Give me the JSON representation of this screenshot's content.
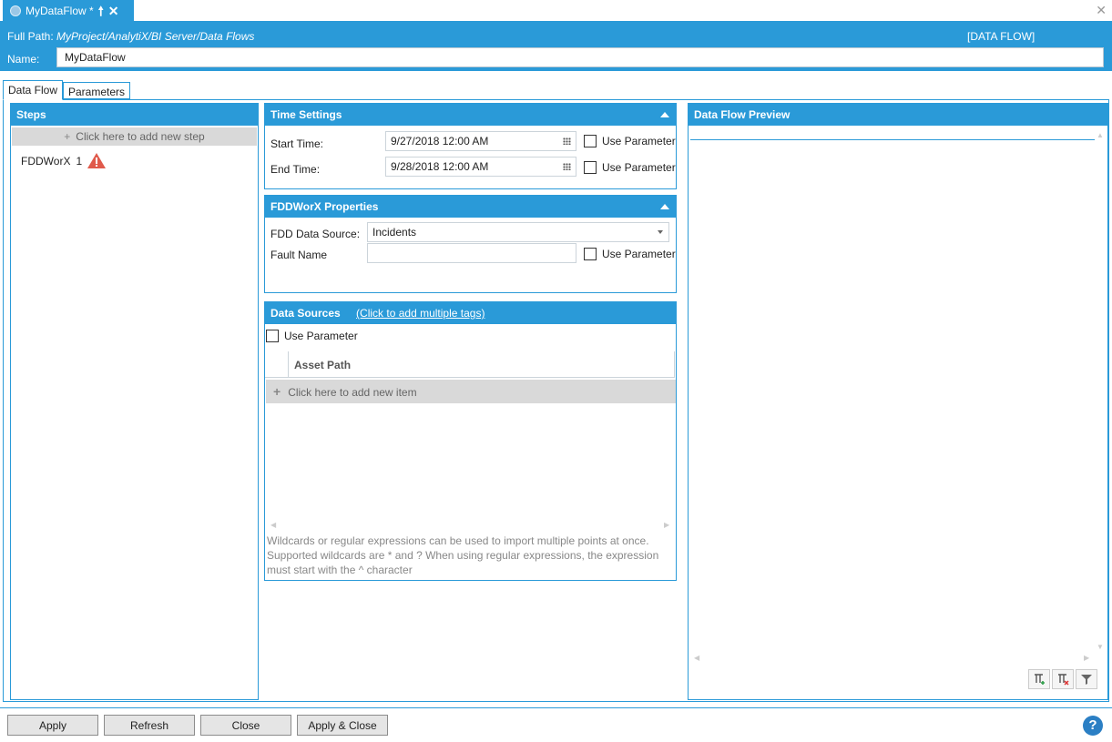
{
  "doc_tab": {
    "title": "MyDataFlow *"
  },
  "header": {
    "full_path_label": "Full Path:",
    "full_path_value": "MyProject/AnalytiX/BI Server/Data Flows",
    "type_badge": "[DATA FLOW]",
    "name_label": "Name:",
    "name_value": "MyDataFlow"
  },
  "tabs": [
    {
      "label": "Data Flow",
      "active": true
    },
    {
      "label": "Parameters",
      "active": false
    }
  ],
  "steps": {
    "title": "Steps",
    "add_label": "Click here to add new step",
    "items": [
      {
        "name": "FDDWorX",
        "index": "1",
        "status_icon": "warning-icon"
      }
    ]
  },
  "time_settings": {
    "title": "Time Settings",
    "start_label": "Start Time:",
    "start_value": "9/27/2018 12:00 AM",
    "end_label": "End Time:",
    "end_value": "9/28/2018 12:00 AM",
    "use_parameter": "Use Parameter"
  },
  "fdd_properties": {
    "title": "FDDWorX Properties",
    "source_label": "FDD Data Source:",
    "source_value": "Incidents",
    "fault_label": "Fault Name",
    "fault_value": "",
    "use_parameter": "Use Parameter"
  },
  "data_sources": {
    "title": "Data Sources",
    "link": "(Click to add multiple tags)",
    "use_parameter": "Use Parameter",
    "column": "Asset Path",
    "add_label": "Click here to add new item",
    "hint": "Wildcards or regular expressions can be used to import multiple points at once. Supported wildcards are * and ? When using regular expressions, the expression must start with the ^ character"
  },
  "preview": {
    "title": "Data Flow Preview"
  },
  "footer": {
    "apply": "Apply",
    "refresh": "Refresh",
    "close": "Close",
    "apply_close": "Apply & Close",
    "help": "?"
  },
  "colors": {
    "accent": "#2a9ad8",
    "button_bg": "#e5e5e5",
    "warning": "#e05a4b"
  }
}
